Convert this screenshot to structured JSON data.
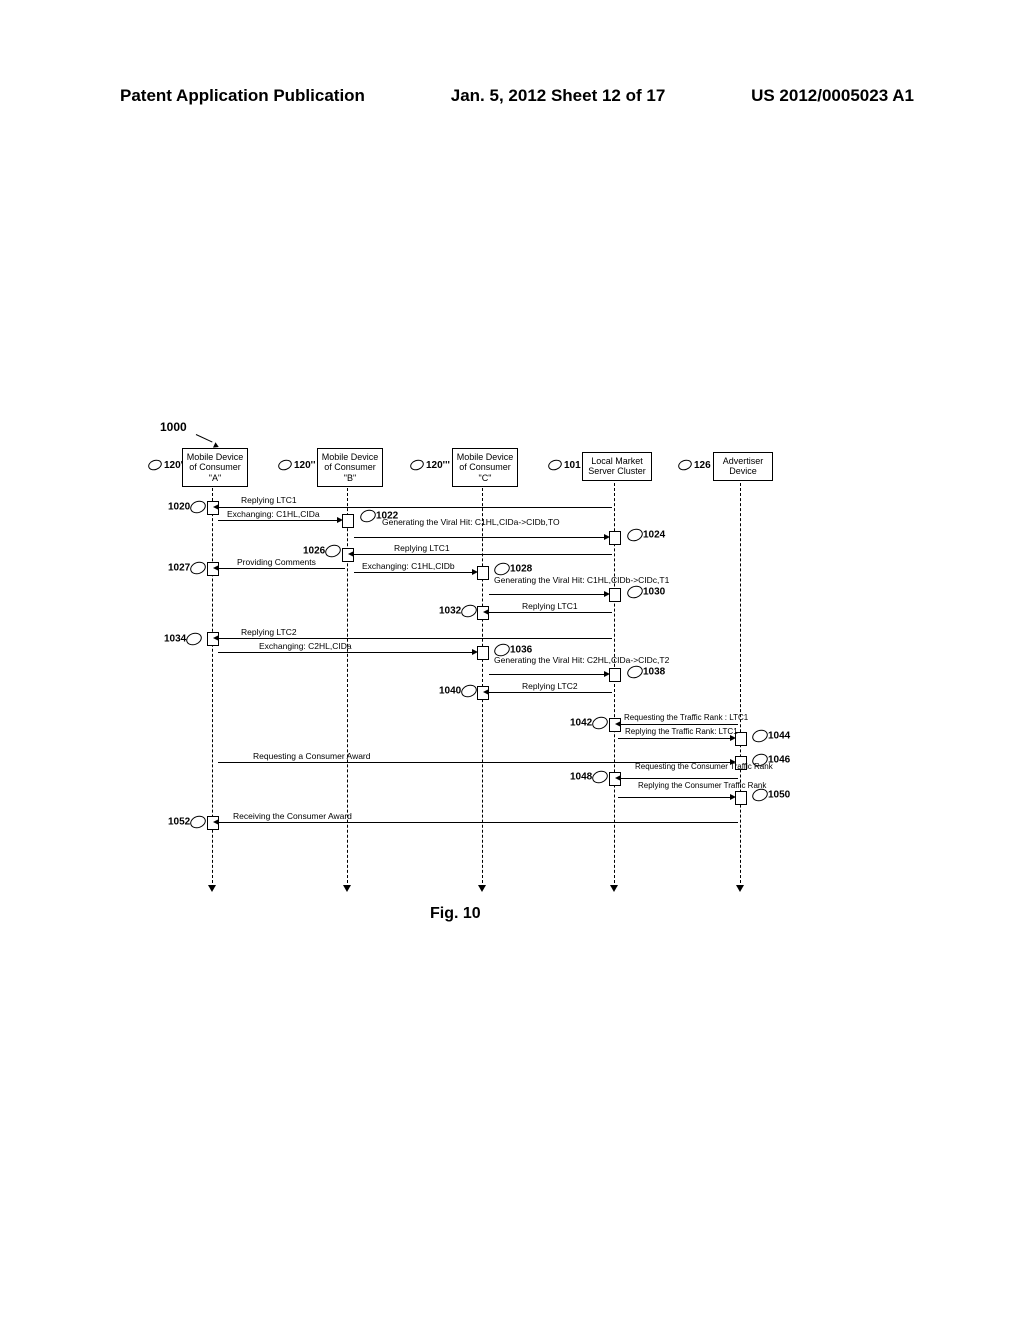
{
  "header": {
    "left": "Patent Application Publication",
    "middle": "Jan. 5, 2012   Sheet 12 of 17",
    "right": "US 2012/0005023 A1"
  },
  "diagram_number": "1000",
  "actors": {
    "a1": {
      "ref": "120'",
      "label": "Mobile Device of Consumer \"A\""
    },
    "a2": {
      "ref": "120''",
      "label": "Mobile Device of Consumer \"B\""
    },
    "a3": {
      "ref": "120'''",
      "label": "Mobile Device of Consumer \"C\""
    },
    "a4": {
      "ref": "101",
      "label": "Local Market Server Cluster"
    },
    "a5": {
      "ref": "126",
      "label": "Advertiser Device"
    }
  },
  "messages": {
    "m1020": {
      "ref": "1020",
      "text": "Replying LTC1"
    },
    "m1022": {
      "ref": "1022",
      "text": "Exchanging: C1HL,CIDa"
    },
    "m1024": {
      "ref": "1024",
      "text": "Generating the Viral Hit: C1HL,CIDa->CIDb,TO"
    },
    "m1026": {
      "ref": "1026",
      "text": "Replying LTC1"
    },
    "m1027": {
      "ref": "1027",
      "text": "Providing Comments"
    },
    "m1028": {
      "ref": "1028",
      "text": "Exchanging: C1HL,CIDb"
    },
    "m1030": {
      "ref": "1030",
      "text": "Generating the Viral Hit: C1HL,CIDb->CIDc,T1"
    },
    "m1032": {
      "ref": "1032",
      "text": "Replying LTC1"
    },
    "m1034": {
      "ref": "1034",
      "text": "Replying LTC2"
    },
    "m1036": {
      "ref": "1036",
      "text": "Exchanging: C2HL,CIDa"
    },
    "m1038": {
      "ref": "1038",
      "text": "Generating the Viral Hit: C2HL,CIDa->CIDc,T2"
    },
    "m1040": {
      "ref": "1040",
      "text": "Replying LTC2"
    },
    "m1042": {
      "ref": "1042",
      "text": "Requesting the Traffic Rank : LTC1"
    },
    "m1044": {
      "ref": "1044",
      "text": "Replying the Traffic Rank: LTC1"
    },
    "m1046": {
      "ref": "1046",
      "text": "Requesting a Consumer Award"
    },
    "m1048": {
      "ref": "1048",
      "text": "Requesting the Consumer Traffic Rank"
    },
    "m1050": {
      "ref": "1050",
      "text": "Replying the Consumer Traffic Rank"
    },
    "m1052": {
      "ref": "1052",
      "text": "Receiving the Consumer Award"
    }
  },
  "figure_caption": "Fig. 10"
}
